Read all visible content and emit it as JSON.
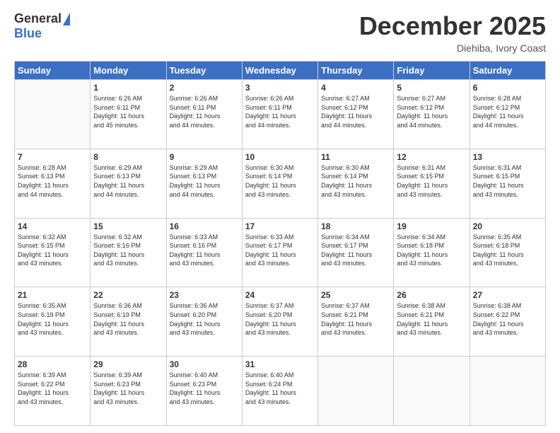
{
  "logo": {
    "general": "General",
    "blue": "Blue"
  },
  "header": {
    "month_year": "December 2025",
    "location": "Diehiba, Ivory Coast"
  },
  "days_of_week": [
    "Sunday",
    "Monday",
    "Tuesday",
    "Wednesday",
    "Thursday",
    "Friday",
    "Saturday"
  ],
  "weeks": [
    [
      {
        "day": "",
        "info": ""
      },
      {
        "day": "1",
        "info": "Sunrise: 6:26 AM\nSunset: 6:11 PM\nDaylight: 11 hours\nand 45 minutes."
      },
      {
        "day": "2",
        "info": "Sunrise: 6:26 AM\nSunset: 6:11 PM\nDaylight: 11 hours\nand 44 minutes."
      },
      {
        "day": "3",
        "info": "Sunrise: 6:26 AM\nSunset: 6:11 PM\nDaylight: 11 hours\nand 44 minutes."
      },
      {
        "day": "4",
        "info": "Sunrise: 6:27 AM\nSunset: 6:12 PM\nDaylight: 11 hours\nand 44 minutes."
      },
      {
        "day": "5",
        "info": "Sunrise: 6:27 AM\nSunset: 6:12 PM\nDaylight: 11 hours\nand 44 minutes."
      },
      {
        "day": "6",
        "info": "Sunrise: 6:28 AM\nSunset: 6:12 PM\nDaylight: 11 hours\nand 44 minutes."
      }
    ],
    [
      {
        "day": "7",
        "info": "Sunrise: 6:28 AM\nSunset: 6:13 PM\nDaylight: 11 hours\nand 44 minutes."
      },
      {
        "day": "8",
        "info": "Sunrise: 6:29 AM\nSunset: 6:13 PM\nDaylight: 11 hours\nand 44 minutes."
      },
      {
        "day": "9",
        "info": "Sunrise: 6:29 AM\nSunset: 6:13 PM\nDaylight: 11 hours\nand 44 minutes."
      },
      {
        "day": "10",
        "info": "Sunrise: 6:30 AM\nSunset: 6:14 PM\nDaylight: 11 hours\nand 43 minutes."
      },
      {
        "day": "11",
        "info": "Sunrise: 6:30 AM\nSunset: 6:14 PM\nDaylight: 11 hours\nand 43 minutes."
      },
      {
        "day": "12",
        "info": "Sunrise: 6:31 AM\nSunset: 6:15 PM\nDaylight: 11 hours\nand 43 minutes."
      },
      {
        "day": "13",
        "info": "Sunrise: 6:31 AM\nSunset: 6:15 PM\nDaylight: 11 hours\nand 43 minutes."
      }
    ],
    [
      {
        "day": "14",
        "info": "Sunrise: 6:32 AM\nSunset: 6:15 PM\nDaylight: 11 hours\nand 43 minutes."
      },
      {
        "day": "15",
        "info": "Sunrise: 6:32 AM\nSunset: 6:16 PM\nDaylight: 11 hours\nand 43 minutes."
      },
      {
        "day": "16",
        "info": "Sunrise: 6:33 AM\nSunset: 6:16 PM\nDaylight: 11 hours\nand 43 minutes."
      },
      {
        "day": "17",
        "info": "Sunrise: 6:33 AM\nSunset: 6:17 PM\nDaylight: 11 hours\nand 43 minutes."
      },
      {
        "day": "18",
        "info": "Sunrise: 6:34 AM\nSunset: 6:17 PM\nDaylight: 11 hours\nand 43 minutes."
      },
      {
        "day": "19",
        "info": "Sunrise: 6:34 AM\nSunset: 6:18 PM\nDaylight: 11 hours\nand 43 minutes."
      },
      {
        "day": "20",
        "info": "Sunrise: 6:35 AM\nSunset: 6:18 PM\nDaylight: 11 hours\nand 43 minutes."
      }
    ],
    [
      {
        "day": "21",
        "info": "Sunrise: 6:35 AM\nSunset: 6:19 PM\nDaylight: 11 hours\nand 43 minutes."
      },
      {
        "day": "22",
        "info": "Sunrise: 6:36 AM\nSunset: 6:19 PM\nDaylight: 11 hours\nand 43 minutes."
      },
      {
        "day": "23",
        "info": "Sunrise: 6:36 AM\nSunset: 6:20 PM\nDaylight: 11 hours\nand 43 minutes."
      },
      {
        "day": "24",
        "info": "Sunrise: 6:37 AM\nSunset: 6:20 PM\nDaylight: 11 hours\nand 43 minutes."
      },
      {
        "day": "25",
        "info": "Sunrise: 6:37 AM\nSunset: 6:21 PM\nDaylight: 11 hours\nand 43 minutes."
      },
      {
        "day": "26",
        "info": "Sunrise: 6:38 AM\nSunset: 6:21 PM\nDaylight: 11 hours\nand 43 minutes."
      },
      {
        "day": "27",
        "info": "Sunrise: 6:38 AM\nSunset: 6:22 PM\nDaylight: 11 hours\nand 43 minutes."
      }
    ],
    [
      {
        "day": "28",
        "info": "Sunrise: 6:39 AM\nSunset: 6:22 PM\nDaylight: 11 hours\nand 43 minutes."
      },
      {
        "day": "29",
        "info": "Sunrise: 6:39 AM\nSunset: 6:23 PM\nDaylight: 11 hours\nand 43 minutes."
      },
      {
        "day": "30",
        "info": "Sunrise: 6:40 AM\nSunset: 6:23 PM\nDaylight: 11 hours\nand 43 minutes."
      },
      {
        "day": "31",
        "info": "Sunrise: 6:40 AM\nSunset: 6:24 PM\nDaylight: 11 hours\nand 43 minutes."
      },
      {
        "day": "",
        "info": ""
      },
      {
        "day": "",
        "info": ""
      },
      {
        "day": "",
        "info": ""
      }
    ]
  ]
}
